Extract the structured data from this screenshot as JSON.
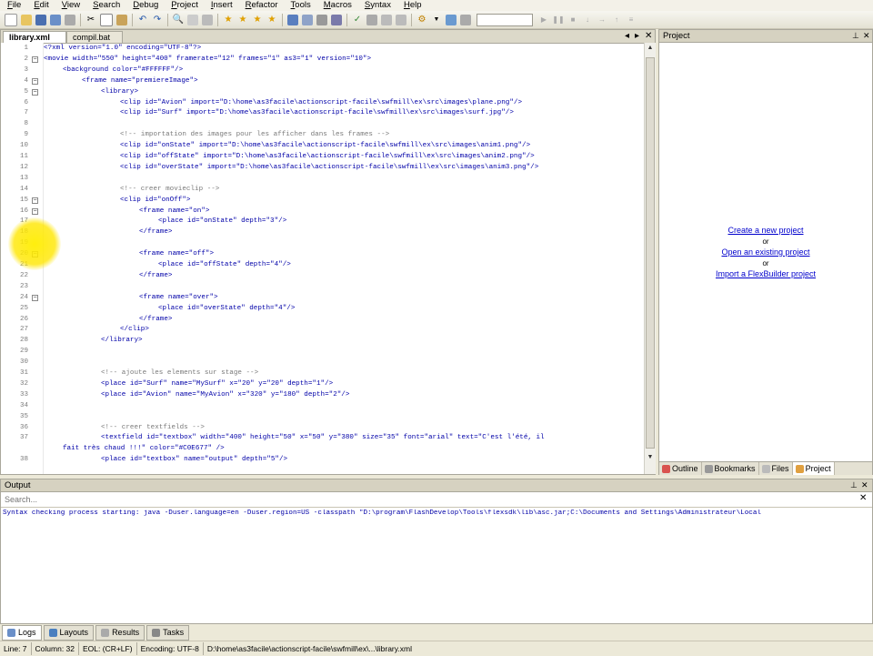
{
  "menu": [
    "File",
    "Edit",
    "View",
    "Search",
    "Debug",
    "Project",
    "Insert",
    "Refactor",
    "Tools",
    "Macros",
    "Syntax",
    "Help"
  ],
  "tabs": [
    {
      "label": "library.xml",
      "active": true
    },
    {
      "label": "compil.bat",
      "active": false
    }
  ],
  "code_lines": [
    {
      "n": "1",
      "text": "<?xml version=\"1.0\" encoding=\"UTF-8\"?>",
      "fold": "",
      "indent": 0,
      "kind": "tag"
    },
    {
      "n": "2",
      "text": "<movie width=\"550\" height=\"400\" framerate=\"12\" frames=\"1\" as3=\"1\" version=\"10\">",
      "fold": "−",
      "indent": 0,
      "kind": "tag"
    },
    {
      "n": "3",
      "text": "<background color=\"#FFFFFF\"/>",
      "fold": "",
      "indent": 1,
      "kind": "tag"
    },
    {
      "n": "4",
      "text": "<frame name=\"premiereImage\">",
      "fold": "−",
      "indent": 2,
      "kind": "tag"
    },
    {
      "n": "5",
      "text": "<library>",
      "fold": "−",
      "indent": 3,
      "kind": "tag"
    },
    {
      "n": "6",
      "text": "<clip id=\"Avion\" import=\"D:\\home\\as3facile\\actionscript-facile\\swfmill\\ex\\src\\images\\plane.png\"/>",
      "fold": "",
      "indent": 4,
      "kind": "tag"
    },
    {
      "n": "7",
      "text": "<clip id=\"Surf\" import=\"D:\\home\\as3facile\\actionscript-facile\\swfmill\\ex\\src\\images\\surf.jpg\"/>",
      "fold": "",
      "indent": 4,
      "kind": "tag"
    },
    {
      "n": "8",
      "text": "",
      "fold": "",
      "indent": 0,
      "kind": "tag"
    },
    {
      "n": "9",
      "text": "<!-- importation des images pour les afficher dans les frames -->",
      "fold": "",
      "indent": 4,
      "kind": "comment"
    },
    {
      "n": "10",
      "text": "<clip id=\"onState\" import=\"D:\\home\\as3facile\\actionscript-facile\\swfmill\\ex\\src\\images\\anim1.png\"/>",
      "fold": "",
      "indent": 4,
      "kind": "tag"
    },
    {
      "n": "11",
      "text": "<clip id=\"offState\" import=\"D:\\home\\as3facile\\actionscript-facile\\swfmill\\ex\\src\\images\\anim2.png\"/>",
      "fold": "",
      "indent": 4,
      "kind": "tag"
    },
    {
      "n": "12",
      "text": "<clip id=\"overState\" import=\"D:\\home\\as3facile\\actionscript-facile\\swfmill\\ex\\src\\images\\anim3.png\"/>",
      "fold": "",
      "indent": 4,
      "kind": "tag"
    },
    {
      "n": "13",
      "text": "",
      "fold": "",
      "indent": 0,
      "kind": "tag"
    },
    {
      "n": "14",
      "text": "<!-- creer movieclip -->",
      "fold": "",
      "indent": 4,
      "kind": "comment"
    },
    {
      "n": "15",
      "text": "<clip id=\"onOff\">",
      "fold": "−",
      "indent": 4,
      "kind": "tag"
    },
    {
      "n": "16",
      "text": "<frame name=\"on\">",
      "fold": "−",
      "indent": 5,
      "kind": "tag"
    },
    {
      "n": "17",
      "text": "<place id=\"onState\" depth=\"3\"/>",
      "fold": "",
      "indent": 6,
      "kind": "tag"
    },
    {
      "n": "18",
      "text": "</frame>",
      "fold": "",
      "indent": 5,
      "kind": "tag"
    },
    {
      "n": "19",
      "text": "",
      "fold": "",
      "indent": 0,
      "kind": "tag"
    },
    {
      "n": "20",
      "text": "<frame name=\"off\">",
      "fold": "−",
      "indent": 5,
      "kind": "tag"
    },
    {
      "n": "21",
      "text": "<place id=\"offState\" depth=\"4\"/>",
      "fold": "",
      "indent": 6,
      "kind": "tag"
    },
    {
      "n": "22",
      "text": "</frame>",
      "fold": "",
      "indent": 5,
      "kind": "tag"
    },
    {
      "n": "23",
      "text": "",
      "fold": "",
      "indent": 0,
      "kind": "tag"
    },
    {
      "n": "24",
      "text": "<frame name=\"over\">",
      "fold": "−",
      "indent": 5,
      "kind": "tag"
    },
    {
      "n": "25",
      "text": "<place id=\"overState\" depth=\"4\"/>",
      "fold": "",
      "indent": 6,
      "kind": "tag"
    },
    {
      "n": "26",
      "text": "</frame>",
      "fold": "",
      "indent": 5,
      "kind": "tag"
    },
    {
      "n": "27",
      "text": "</clip>",
      "fold": "",
      "indent": 4,
      "kind": "tag"
    },
    {
      "n": "28",
      "text": "</library>",
      "fold": "",
      "indent": 3,
      "kind": "tag"
    },
    {
      "n": "29",
      "text": "",
      "fold": "",
      "indent": 0,
      "kind": "tag"
    },
    {
      "n": "30",
      "text": "",
      "fold": "",
      "indent": 0,
      "kind": "tag"
    },
    {
      "n": "31",
      "text": "<!-- ajoute les elements sur stage -->",
      "fold": "",
      "indent": 3,
      "kind": "comment"
    },
    {
      "n": "32",
      "text": "<place id=\"Surf\" name=\"MySurf\" x=\"20\" y=\"20\" depth=\"1\"/>",
      "fold": "",
      "indent": 3,
      "kind": "tag"
    },
    {
      "n": "33",
      "text": "<place id=\"Avion\" name=\"MyAvion\" x=\"320\" y=\"180\" depth=\"2\"/>",
      "fold": "",
      "indent": 3,
      "kind": "tag"
    },
    {
      "n": "34",
      "text": "",
      "fold": "",
      "indent": 0,
      "kind": "tag"
    },
    {
      "n": "35",
      "text": "",
      "fold": "",
      "indent": 0,
      "kind": "tag"
    },
    {
      "n": "36",
      "text": "<!-- creer textfields -->",
      "fold": "",
      "indent": 3,
      "kind": "comment"
    },
    {
      "n": "37",
      "text": "<textfield id=\"textbox\" width=\"400\" height=\"50\" x=\"50\" y=\"380\" size=\"35\" font=\"arial\" text=\"C'est l'été, il",
      "fold": "",
      "indent": 3,
      "kind": "tag"
    },
    {
      "n": "",
      "text": "fait très chaud !!!\" color=\"#C0E677\" />",
      "fold": "",
      "indent": 1,
      "kind": "wrap"
    },
    {
      "n": "38",
      "text": "<place id=\"textbox\" name=\"output\" depth=\"5\"/>",
      "fold": "",
      "indent": 3,
      "kind": "tag"
    }
  ],
  "project_panel": {
    "title": "Project",
    "create": "Create a new project",
    "or1": "or",
    "open": "Open an existing project",
    "or2": "or",
    "import": "Import a FlexBuilder project",
    "tabs": [
      "Outline",
      "Bookmarks",
      "Files",
      "Project"
    ]
  },
  "output_panel": {
    "title": "Output",
    "search_placeholder": "Search...",
    "text": "Syntax checking process starting: java -Duser.language=en -Duser.region=US -classpath \"D:\\program\\FlashDevelop\\Tools\\flexsdk\\lib\\asc.jar;C:\\Documents and Settings\\Administrateur\\Local"
  },
  "bottom_tabs": [
    "Logs",
    "Layouts",
    "Results",
    "Tasks"
  ],
  "status": {
    "line": "Line: 7",
    "column": "Column: 32",
    "eol": "EOL: (CR+LF)",
    "encoding": "Encoding: UTF-8",
    "path": "D:\\home\\as3facile\\actionscript-facile\\swfmill\\ex\\...\\library.xml"
  }
}
